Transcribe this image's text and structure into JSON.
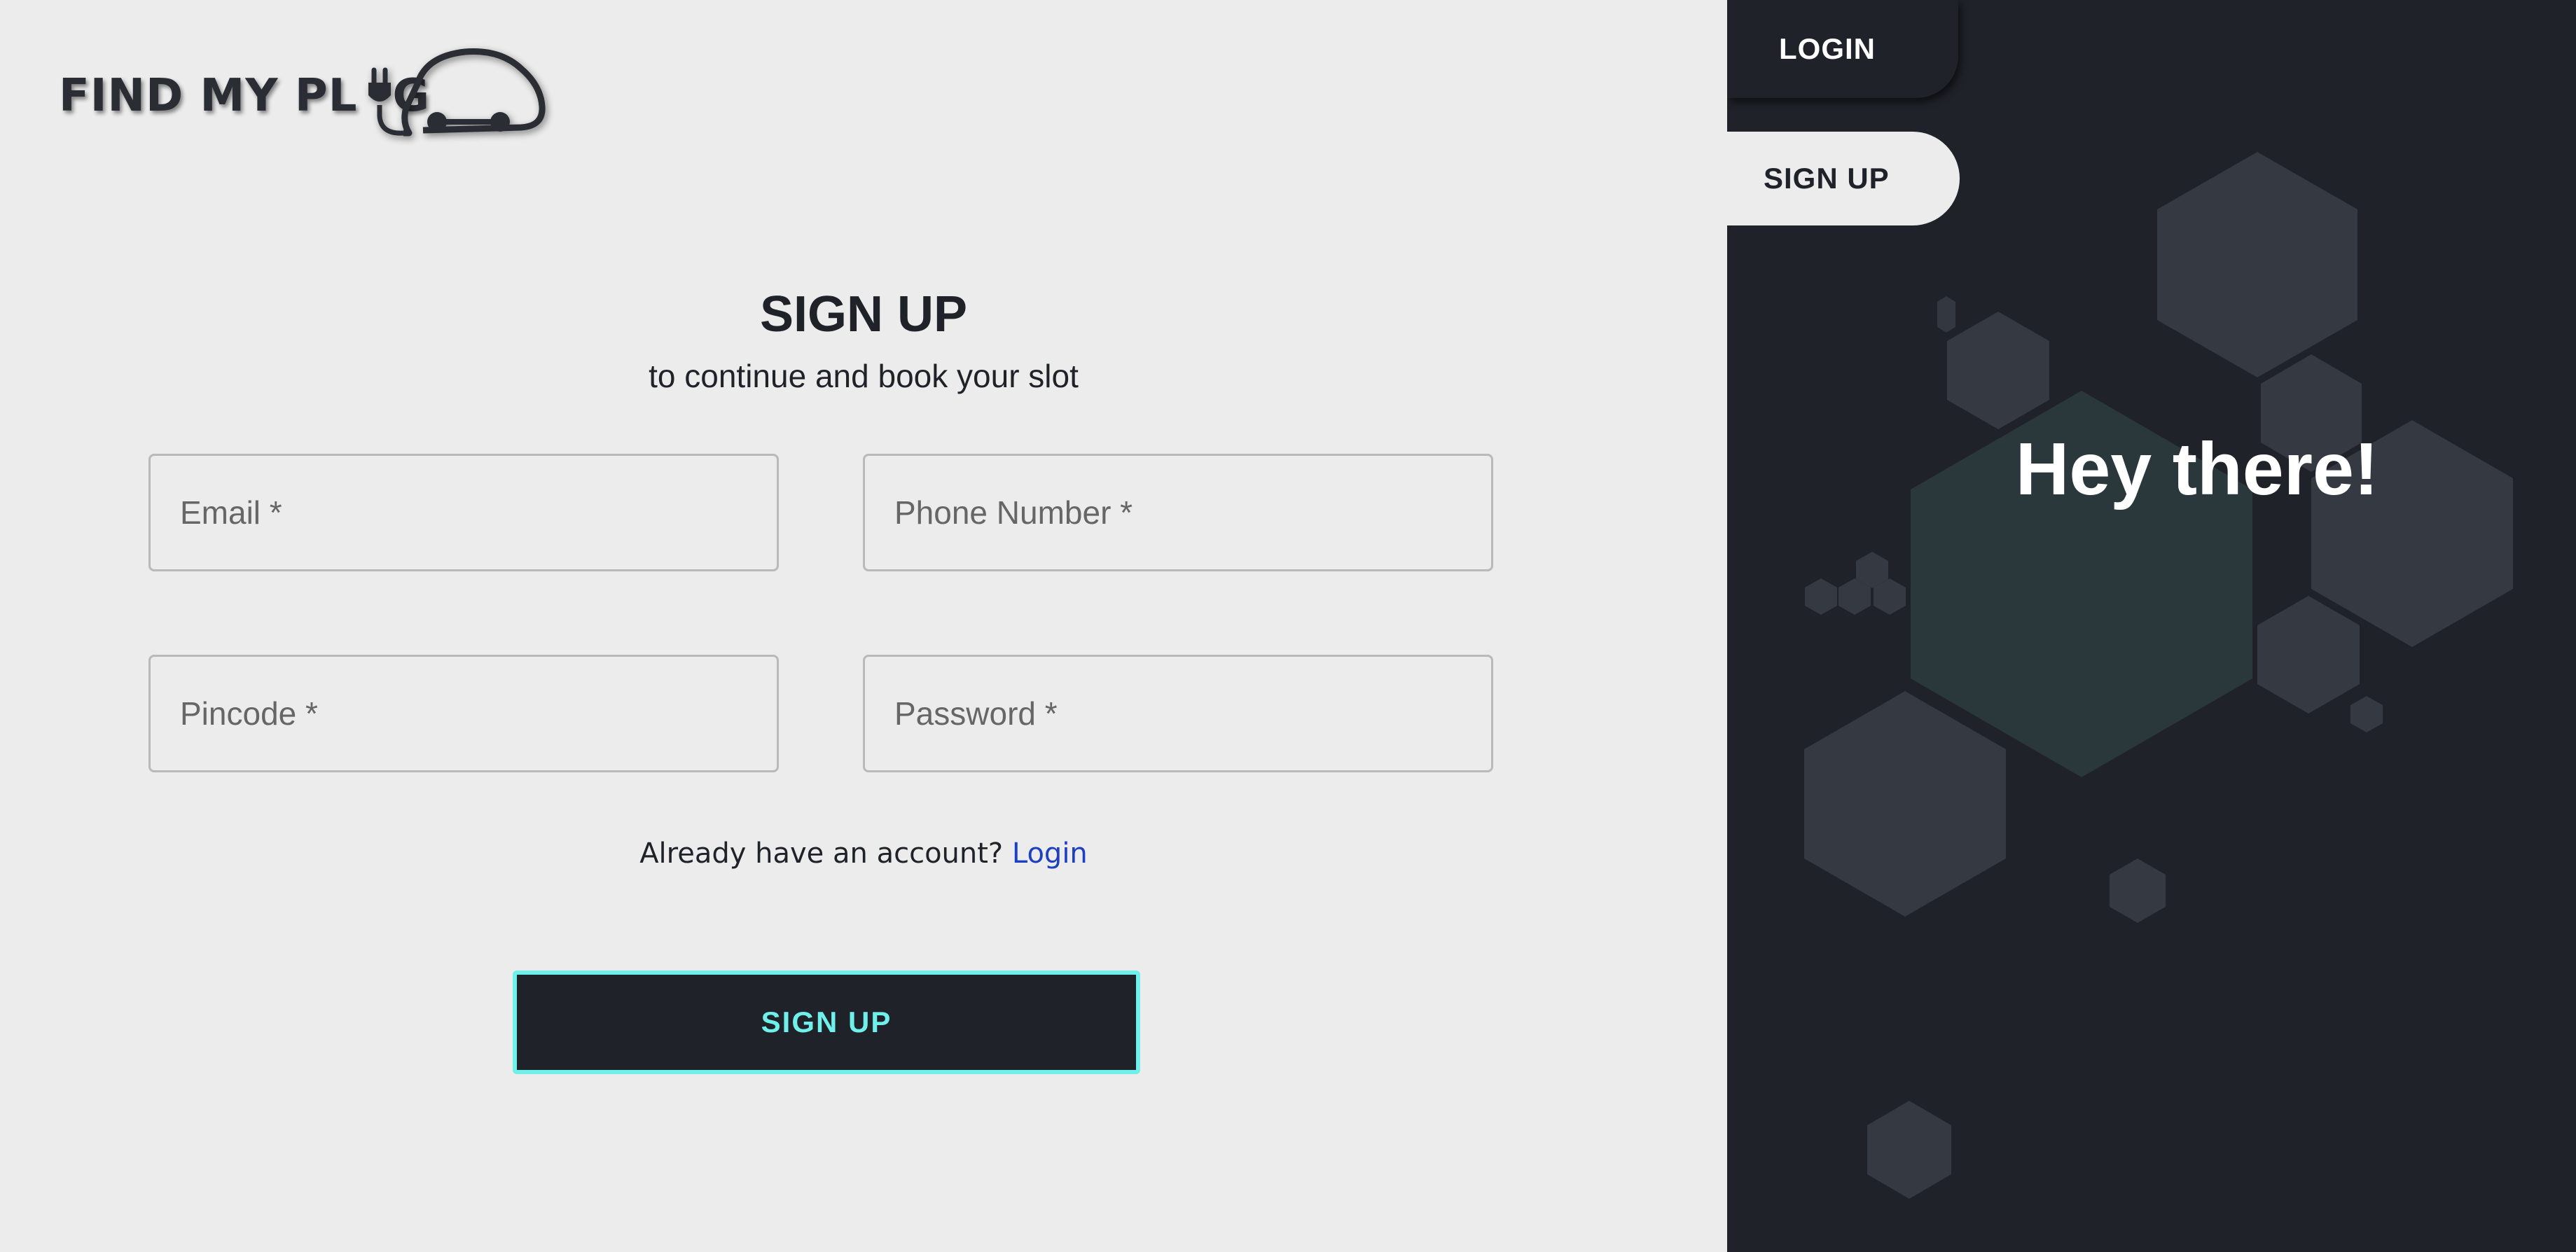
{
  "brand": {
    "logo_text": "FIND MY PLUG",
    "logo_visible": "FIND MY PL",
    "logo_tail": "G"
  },
  "form": {
    "title": "SIGN UP",
    "subtitle": "to continue and book your slot",
    "email_placeholder": "Email *",
    "phone_placeholder": "Phone Number *",
    "pincode_placeholder": "Pincode *",
    "password_placeholder": "Password *",
    "already_text": "Already have an account?",
    "login_link": "Login",
    "submit_label": "SIGN UP"
  },
  "side": {
    "login_tab": "LOGIN",
    "signup_tab": "SIGN UP",
    "greeting": "Hey there!"
  },
  "colors": {
    "dark": "#1f2229",
    "light": "#ececec",
    "accent": "#6ff0ea",
    "link": "#1c3fc4"
  }
}
